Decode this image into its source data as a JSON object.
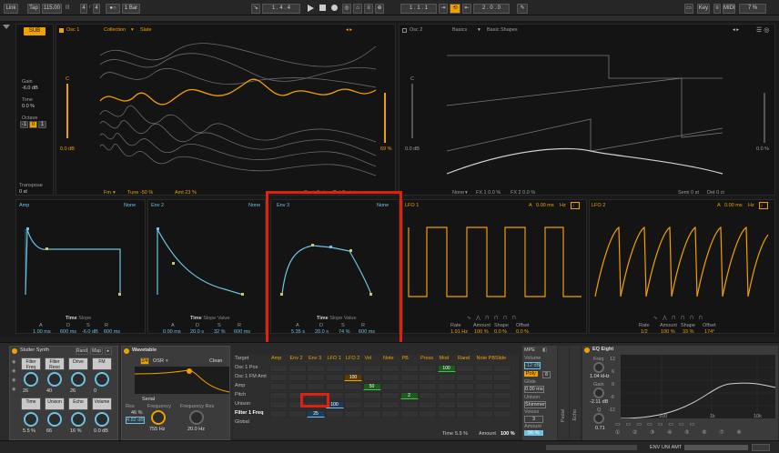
{
  "transport": {
    "link": "Link",
    "tap": "Tap",
    "tempo": "115.00",
    "sig_num": "4",
    "sig_den": "4",
    "quant": "1 Bar",
    "position": "1 . 4 . 4",
    "loop_start": "1 . 1 . 1",
    "loop_len": "2 . 0 . 0",
    "key": "Key",
    "midi": "MIDI",
    "cpu": "7 %"
  },
  "osc1": {
    "title": "Osc 1",
    "collection": "Collection",
    "preset": "Slate",
    "level_label": "C",
    "level_db": "0.0 dB",
    "gain_label": "Gain",
    "gain_val": "-6.0 dB",
    "tone_label": "Tone",
    "tone_val": "0.0 %",
    "octave_label": "Octave",
    "octave_vals": [
      "-1",
      "0",
      "1"
    ],
    "transpose_label": "Transpose",
    "transpose_val": "0 st",
    "fm_label": "Fm",
    "tune": "Tune -50 %",
    "amt": "Amt 23 %",
    "semi": "Semi 0 st",
    "det": "Det 0 ct",
    "pos": "69 %",
    "sub": "SUB"
  },
  "osc2": {
    "title": "Osc 2",
    "category": "Basics",
    "preset": "Basic Shapes",
    "level_label": "C",
    "level_db": "0.0 dB",
    "fx_none": "None",
    "fx1": "FX 1 0.0 %",
    "fx2": "FX 2 0.0 %",
    "semi": "Semi 0 st",
    "det": "Det 0 ct",
    "pos": "0.0 %"
  },
  "env": [
    {
      "title": "Amp",
      "mode": "None",
      "a": "1.00 ms",
      "d": "600 ms",
      "s": "-6.0 dB",
      "r": "600 ms"
    },
    {
      "title": "Env 2",
      "mode": "None",
      "a": "0.00 ms",
      "d": "20.0 s",
      "s": "32 %",
      "r": "600 ms"
    },
    {
      "title": "Env 3",
      "mode": "None",
      "a": "5.35 s",
      "d": "20.0 s",
      "s": "74 %",
      "r": "600 ms"
    }
  ],
  "env_params": {
    "a": "A",
    "d": "D",
    "s": "S",
    "r": "R",
    "time": "Time",
    "slope": "Slope",
    "value": "Value"
  },
  "lfo1": {
    "title": "LFO 1",
    "a": "A",
    "a_val": "0.00 ms",
    "hz": "Hz",
    "rate_l": "Rate",
    "rate": "1.91 Hz",
    "amount_l": "Amount",
    "amount": "100 %",
    "shape_l": "Shape",
    "shape": "0.0 %",
    "offset_l": "Offset",
    "offset": "0.0 %"
  },
  "lfo2": {
    "title": "LFO 2",
    "a": "A",
    "a_val": "0.00 ms",
    "hz": "Hz",
    "rate_l": "Rate",
    "rate": "1/2",
    "amount_l": "Amount",
    "amount": "100 %",
    "shape_l": "Shape",
    "shape": "33 %",
    "offset_l": "Offset",
    "offset": "174°"
  },
  "rack": {
    "title": "Stutter Synth",
    "rand": "Rand",
    "map": "Map",
    "macros": [
      {
        "name": "Filter Freq",
        "val": "26"
      },
      {
        "name": "Filter Reso",
        "val": "40"
      },
      {
        "name": "Drive",
        "val": "26"
      },
      {
        "name": "FM",
        "val": "0"
      },
      {
        "name": "Time",
        "val": "5.5 %"
      },
      {
        "name": "Unison",
        "val": "66"
      },
      {
        "name": "Echo",
        "val": "16 %"
      },
      {
        "name": "Volume",
        "val": "0.0 dB"
      }
    ]
  },
  "wavetable": {
    "title": "Wavetable",
    "filter_num": "2/4",
    "filter_type": "OSR",
    "clean": "Clean",
    "serial": "Serial",
    "res_label": "Res",
    "res_val": "46 %",
    "res_freq": "4.82 dB",
    "freq_label": "Frequency",
    "freq_val": "755 Hz",
    "freq_res_label": "Frequency Res",
    "freq_res_val": "20.0 Hz"
  },
  "matrix": {
    "cols": [
      "Amp",
      "Env 2",
      "Env 3",
      "LFO 1",
      "LFO 2",
      "Vel",
      "Note",
      "PB",
      "Press",
      "Mod",
      "Rand",
      "Note PB",
      "Slide"
    ],
    "rows": [
      "Target",
      "Osc 1 Pos",
      "Osc 1 FM Amt",
      "Amp",
      "Pitch",
      "Unison",
      "Filter 1 Freq",
      "Global"
    ],
    "v_osc1pos": "100",
    "v_fmamt": "100",
    "v_amp": "50",
    "v_pitch": "2",
    "v_unison": "100",
    "v_filter": "25",
    "time_label": "Time",
    "time_val": "5.5 %",
    "amount_label": "Amount",
    "amount_val": "100 %"
  },
  "mpe": {
    "title": "MPE",
    "volume_l": "Volume",
    "volume_v": "-12 dB",
    "poly_l": "Poly",
    "poly_v": "8",
    "glide_l": "Glide",
    "glide_v": "0.00 ms",
    "unison_l": "Unison",
    "unison_mode": "Shimmer",
    "voices_l": "Voices",
    "voices_v": "3",
    "amount_l": "Amount",
    "amount_v": "56 %"
  },
  "eq": {
    "title": "EQ Eight",
    "freq_l": "Freq",
    "freq_v": "1.04 kHz",
    "gain_l": "Gain",
    "gain_v": "-2.11 dB",
    "q_l": "Q",
    "q_v": "0.71",
    "y_ticks": [
      "12",
      "6",
      "0",
      "-6",
      "-12"
    ],
    "x_ticks": [
      "100",
      "1k",
      "10k"
    ],
    "side_labels": [
      "Pedal",
      "Echo"
    ]
  },
  "statusbar": {
    "text": "ENV UNI AMT"
  }
}
